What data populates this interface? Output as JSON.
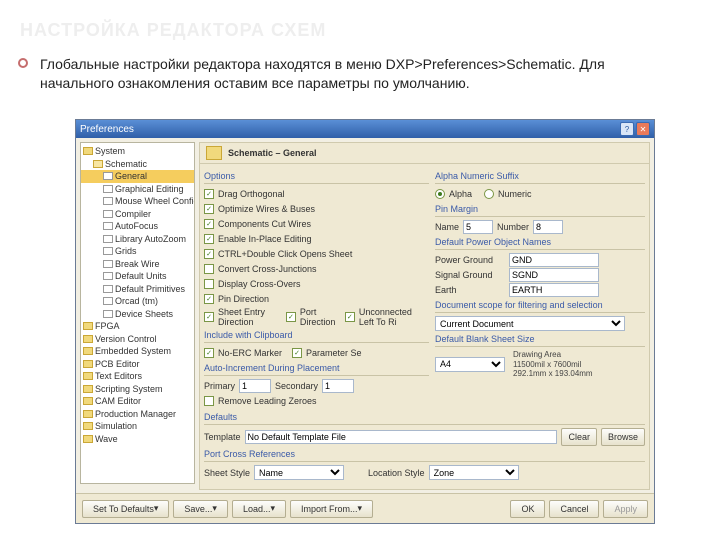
{
  "slide": {
    "title": "НАСТРОЙКА РЕДАКТОРА СХЕМ",
    "body": "Глобальные настройки редактора находятся в меню DXP>Preferences>Schematic. Для начального ознакомления оставим все параметры по умолчанию."
  },
  "dialog": {
    "title": "Preferences"
  },
  "tree": [
    "System",
    "Schematic",
    "General",
    "Graphical Editing",
    "Mouse Wheel Configuration",
    "Compiler",
    "AutoFocus",
    "Library AutoZoom",
    "Grids",
    "Break Wire",
    "Default Units",
    "Default Primitives",
    "Orcad (tm)",
    "Device Sheets",
    "FPGA",
    "Version Control",
    "Embedded System",
    "PCB Editor",
    "Text Editors",
    "Scripting System",
    "CAM Editor",
    "Production Manager",
    "Simulation",
    "Wave"
  ],
  "crumb": "Schematic – General",
  "options": {
    "title": "Options",
    "items": [
      "Drag Orthogonal",
      "Optimize Wires & Buses",
      "Components Cut Wires",
      "Enable In-Place Editing",
      "CTRL+Double Click Opens Sheet",
      "Convert Cross-Junctions",
      "Display Cross-Overs",
      "Pin Direction",
      "Sheet Entry Direction",
      "Port Direction",
      "Unconnected Left To Ri"
    ],
    "checked": [
      true,
      true,
      true,
      true,
      true,
      false,
      false,
      true,
      true,
      true,
      true
    ]
  },
  "clipboard": {
    "title": "Include with Clipboard",
    "noerc": "No-ERC Marker",
    "param": "Parameter Se"
  },
  "autoinc": {
    "title": "Auto-Increment During Placement",
    "primary_lbl": "Primary",
    "primary": "1",
    "secondary_lbl": "Secondary",
    "secondary": "1",
    "remove": "Remove Leading Zeroes"
  },
  "defaults": {
    "title": "Defaults",
    "template_lbl": "Template",
    "template": "No Default Template File",
    "clear": "Clear",
    "browse": "Browse"
  },
  "portcross": {
    "title": "Port Cross References",
    "sheet_lbl": "Sheet Style",
    "sheet": "Name",
    "loc_lbl": "Location Style",
    "loc": "Zone"
  },
  "suffix": {
    "title": "Alpha Numeric Suffix",
    "alpha": "Alpha",
    "numeric": "Numeric"
  },
  "pinmargin": {
    "title": "Pin Margin",
    "name_lbl": "Name",
    "name": "5",
    "num_lbl": "Number",
    "num": "8"
  },
  "power": {
    "title": "Default Power Object Names",
    "pg_lbl": "Power Ground",
    "pg": "GND",
    "sg_lbl": "Signal Ground",
    "sg": "SGND",
    "earth_lbl": "Earth",
    "earth": "EARTH"
  },
  "docscope": {
    "title": "Document scope for filtering and selection",
    "val": "Current Document"
  },
  "sheet": {
    "title": "Default Blank Sheet Size",
    "val": "A4",
    "area_title": "Drawing Area",
    "area1": "11500mil x 7600mil",
    "area2": "292.1mm x 193.04mm"
  },
  "footer": {
    "defaults": "Set To Defaults",
    "save": "Save...",
    "load": "Load...",
    "import": "Import From...",
    "ok": "OK",
    "cancel": "Cancel",
    "apply": "Apply"
  }
}
